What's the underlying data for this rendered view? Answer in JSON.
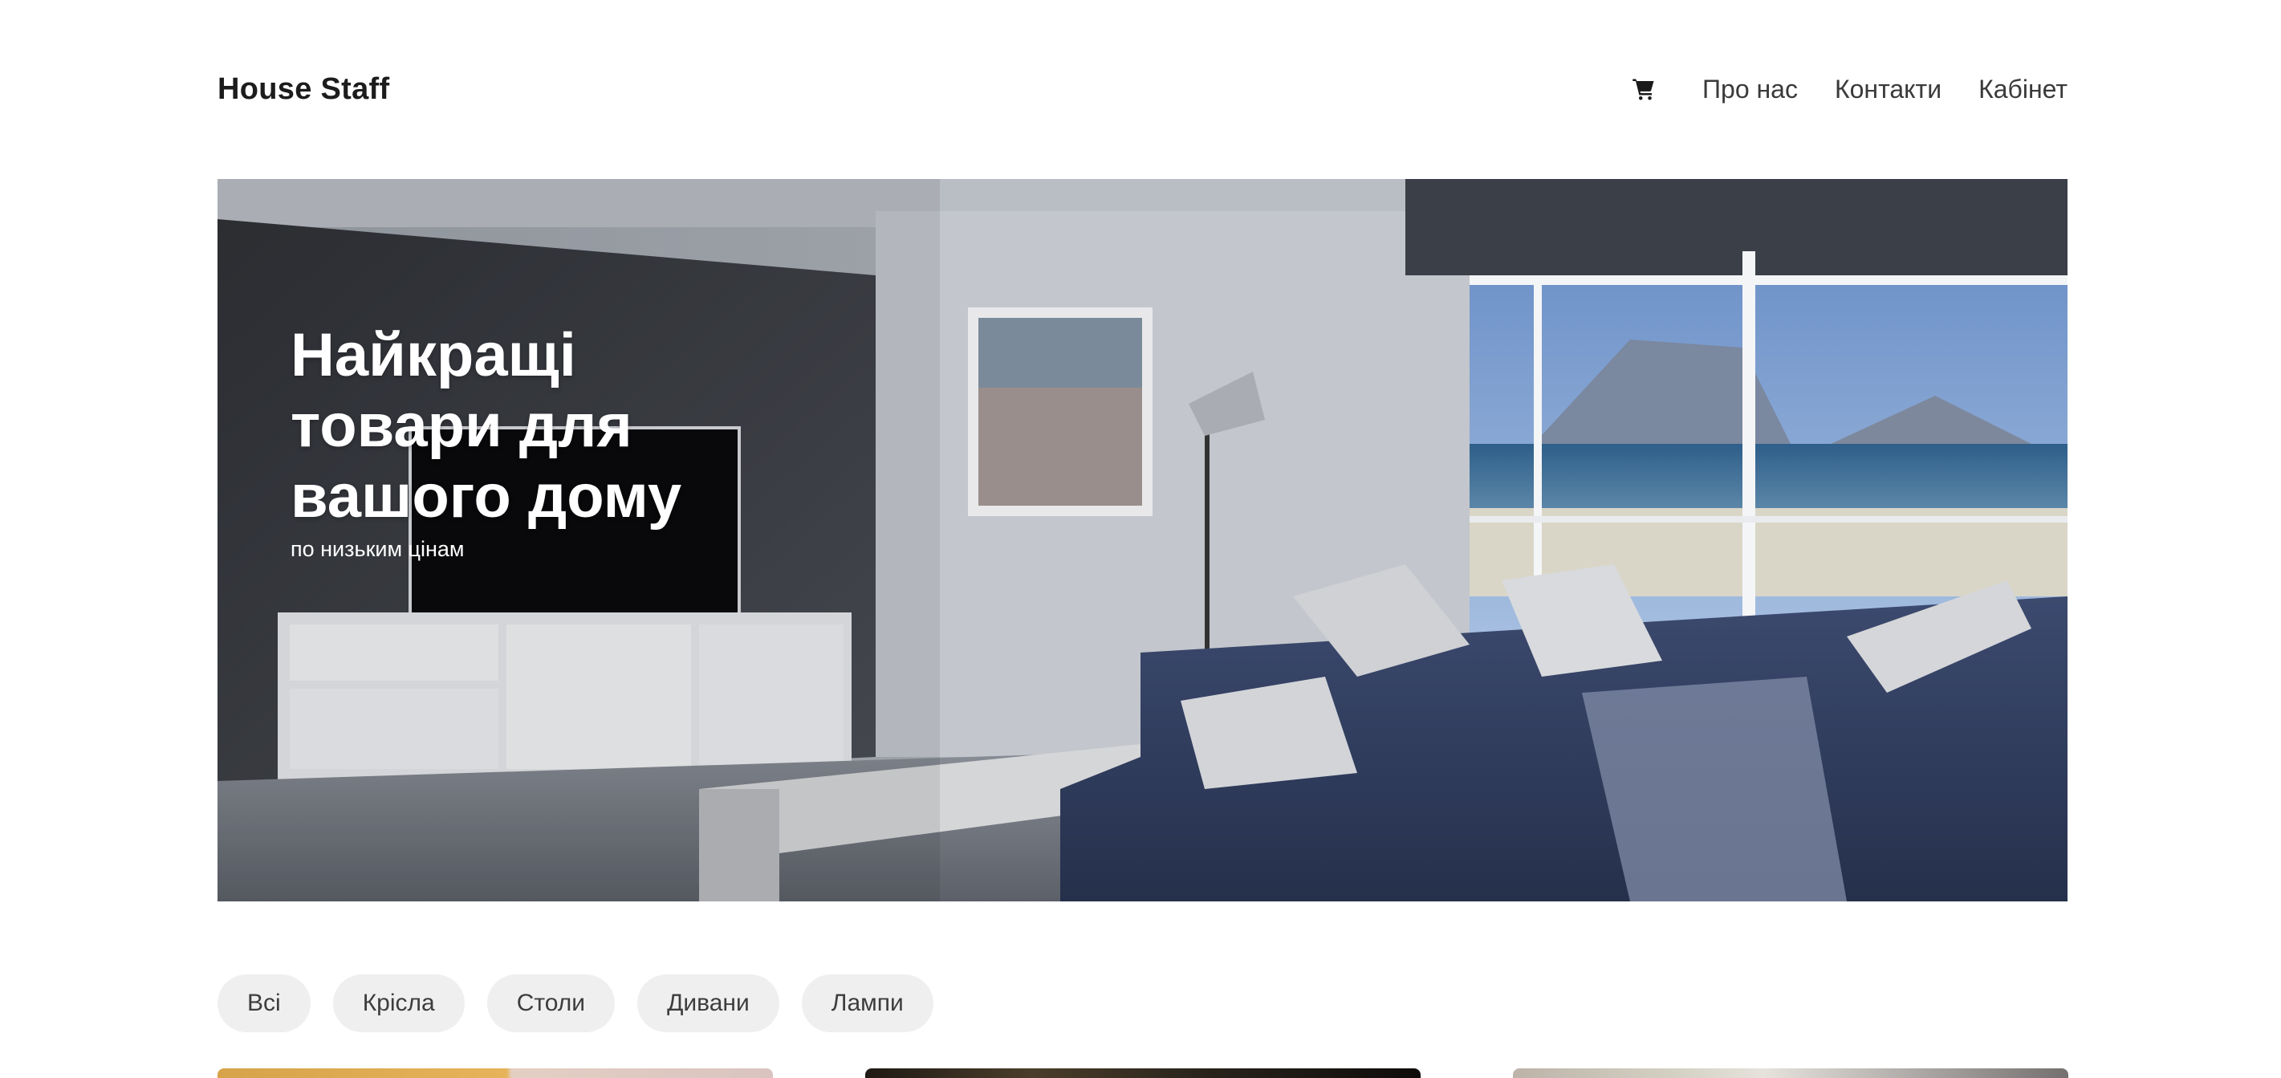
{
  "header": {
    "brand": "House Staff",
    "nav": [
      {
        "label": "Про нас"
      },
      {
        "label": "Контакти"
      },
      {
        "label": "Кабінет"
      }
    ]
  },
  "hero": {
    "title": "Найкращі товари для вашого дому",
    "subtitle": "по низьким цінам"
  },
  "filters": [
    {
      "label": "Всі"
    },
    {
      "label": "Крісла"
    },
    {
      "label": "Столи"
    },
    {
      "label": "Дивани"
    },
    {
      "label": "Лампи"
    }
  ],
  "icons": {
    "cart": "shopping-cart-icon"
  },
  "colors": {
    "chip_bg": "#efefef",
    "text_dark": "#1c1c1c",
    "hero_text": "#ffffff"
  }
}
